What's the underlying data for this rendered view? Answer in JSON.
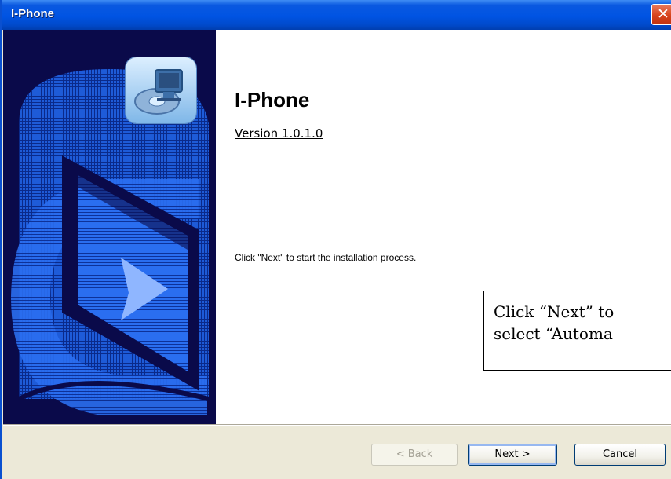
{
  "window": {
    "title": "I-Phone",
    "close_glyph": "✕"
  },
  "header": {
    "app_name": "I-Phone",
    "version": "Version 1.0.1.0"
  },
  "body": {
    "instruction": "Click \"Next\" to start the installation process."
  },
  "callout": {
    "line1": "Click “Next” to",
    "line2": "select “Automa"
  },
  "buttons": {
    "back": "< Back",
    "next": "Next >",
    "cancel": "Cancel"
  },
  "icons": {
    "app_icon": "computer-disk-icon",
    "close_icon": "close-icon"
  },
  "colors": {
    "title_bar": "#0054e3",
    "side_panel": "#0a0a4a",
    "dialog_bg": "#ece9d8",
    "close_button": "#d8431c"
  }
}
